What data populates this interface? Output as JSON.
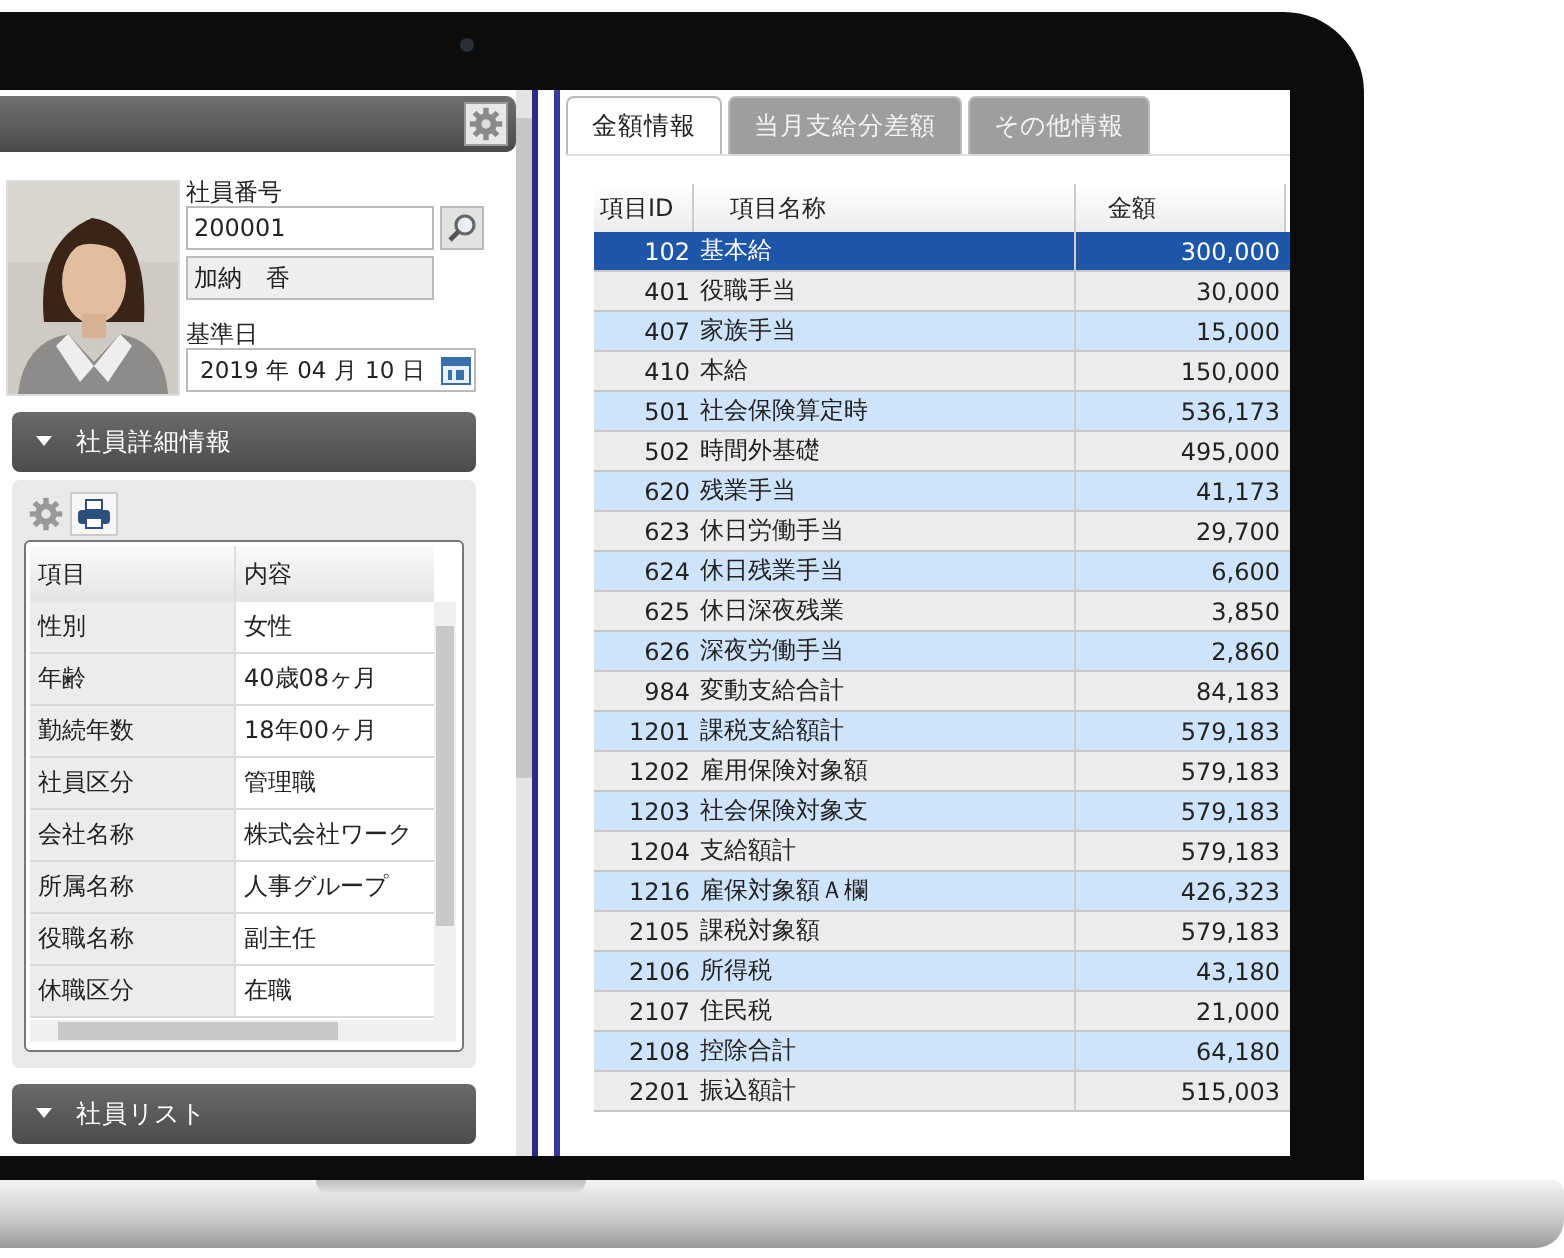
{
  "left_panel": {
    "employee_no_label": "社員番号",
    "employee_no": "200001",
    "employee_name": "加納　香",
    "base_date_label": "基準日",
    "base_date": "2019 年 04 月 10 日"
  },
  "detail_section": {
    "title": "社員詳細情報",
    "columns": [
      "項目",
      "内容"
    ],
    "rows": [
      {
        "item": "性別",
        "value": "女性"
      },
      {
        "item": "年齢",
        "value": "40歳08ヶ月"
      },
      {
        "item": "勤続年数",
        "value": "18年00ヶ月"
      },
      {
        "item": "社員区分",
        "value": "管理職"
      },
      {
        "item": "会社名称",
        "value": "株式会社ワーク"
      },
      {
        "item": "所属名称",
        "value": "人事グループ"
      },
      {
        "item": "役職名称",
        "value": "副主任"
      },
      {
        "item": "休職区分",
        "value": "在職"
      }
    ]
  },
  "list_section": {
    "title": "社員リスト"
  },
  "tabs": [
    {
      "label": "金額情報",
      "selected": true
    },
    {
      "label": "当月支給分差額",
      "selected": false
    },
    {
      "label": "その他情報",
      "selected": false
    }
  ],
  "grid": {
    "columns": [
      "項目ID",
      "項目名称",
      "金額"
    ],
    "rows": [
      {
        "id": "102",
        "name": "基本給",
        "amount": "300,000",
        "selected": true
      },
      {
        "id": "401",
        "name": "役職手当",
        "amount": "30,000",
        "selected": false
      },
      {
        "id": "407",
        "name": "家族手当",
        "amount": "15,000",
        "selected": false
      },
      {
        "id": "410",
        "name": "本給",
        "amount": "150,000",
        "selected": false
      },
      {
        "id": "501",
        "name": "社会保険算定時",
        "amount": "536,173",
        "selected": false
      },
      {
        "id": "502",
        "name": "時間外基礎",
        "amount": "495,000",
        "selected": false
      },
      {
        "id": "620",
        "name": "残業手当",
        "amount": "41,173",
        "selected": false
      },
      {
        "id": "623",
        "name": "休日労働手当",
        "amount": "29,700",
        "selected": false
      },
      {
        "id": "624",
        "name": "休日残業手当",
        "amount": "6,600",
        "selected": false
      },
      {
        "id": "625",
        "name": "休日深夜残業",
        "amount": "3,850",
        "selected": false
      },
      {
        "id": "626",
        "name": "深夜労働手当",
        "amount": "2,860",
        "selected": false
      },
      {
        "id": "984",
        "name": "変動支給合計",
        "amount": "84,183",
        "selected": false
      },
      {
        "id": "1201",
        "name": "課税支給額計",
        "amount": "579,183",
        "selected": false
      },
      {
        "id": "1202",
        "name": "雇用保険対象額",
        "amount": "579,183",
        "selected": false
      },
      {
        "id": "1203",
        "name": "社会保険対象支",
        "amount": "579,183",
        "selected": false
      },
      {
        "id": "1204",
        "name": "支給額計",
        "amount": "579,183",
        "selected": false
      },
      {
        "id": "1216",
        "name": "雇保対象額Ａ欄",
        "amount": "426,323",
        "selected": false
      },
      {
        "id": "2105",
        "name": "課税対象額",
        "amount": "579,183",
        "selected": false
      },
      {
        "id": "2106",
        "name": "所得税",
        "amount": "43,180",
        "selected": false
      },
      {
        "id": "2107",
        "name": "住民税",
        "amount": "21,000",
        "selected": false
      },
      {
        "id": "2108",
        "name": "控除合計",
        "amount": "64,180",
        "selected": false
      },
      {
        "id": "2201",
        "name": "振込額計",
        "amount": "515,003",
        "selected": false
      }
    ]
  }
}
